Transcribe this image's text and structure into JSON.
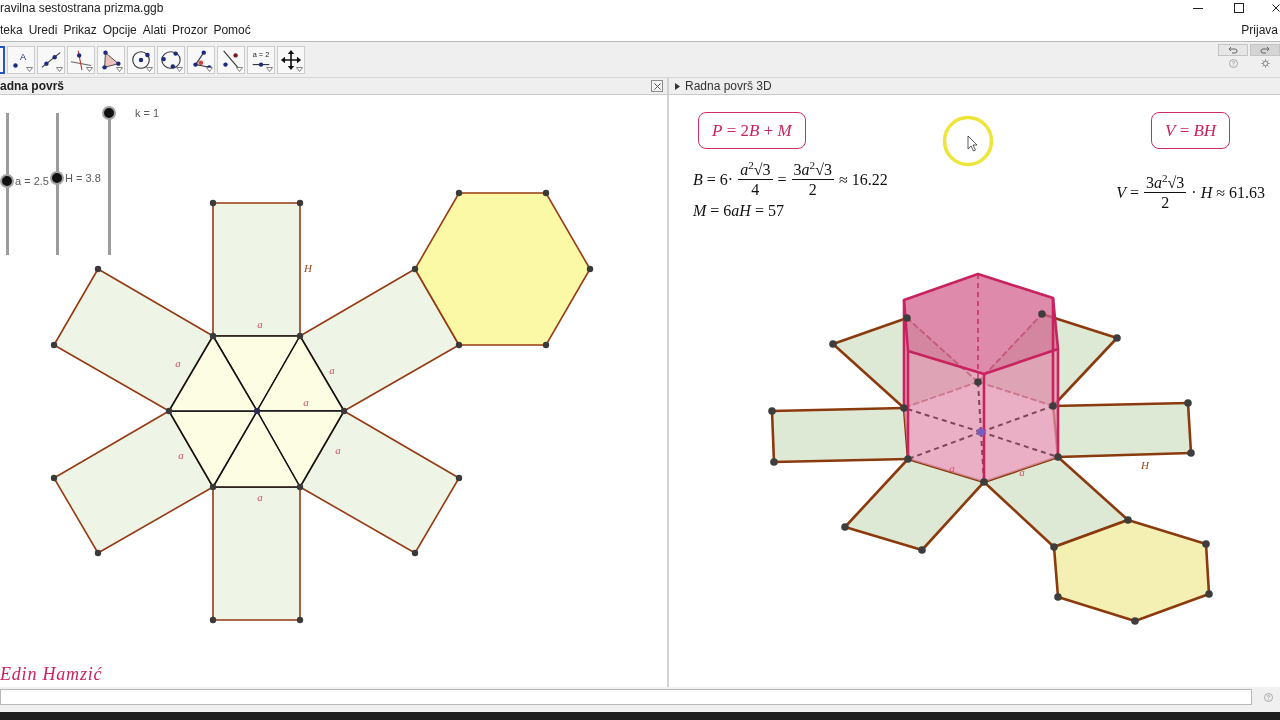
{
  "window": {
    "title": "ravilna sestostrana prizma.ggb"
  },
  "menu": {
    "items": [
      "teka",
      "Uredi",
      "Prikaz",
      "Opcije",
      "Alati",
      "Prozor",
      "Pomoć"
    ],
    "sign_in": "Prijava"
  },
  "toolbar": {
    "tools": [
      {
        "kind": "move",
        "selected": true
      },
      {
        "kind": "point",
        "selected": false,
        "text": "A"
      },
      {
        "kind": "line",
        "selected": false
      },
      {
        "kind": "perpendicular",
        "selected": false
      },
      {
        "kind": "polygon",
        "selected": false
      },
      {
        "kind": "circle",
        "selected": false
      },
      {
        "kind": "circle_three_points",
        "selected": false
      },
      {
        "kind": "angle",
        "selected": false
      },
      {
        "kind": "reflect",
        "selected": false
      },
      {
        "kind": "slider",
        "selected": false,
        "text": "a = 2"
      },
      {
        "kind": "move_view",
        "selected": false
      }
    ]
  },
  "graphics_view": {
    "title": "adna površ",
    "active": true,
    "sliders": [
      {
        "label": "a = 2.5",
        "level": 0.52
      },
      {
        "label": "H = 3.8",
        "level": 0.54
      },
      {
        "label": "k = 1",
        "level": 1
      }
    ],
    "labels": [
      {
        "kind": "height",
        "text": "H"
      },
      {
        "kind": "edge",
        "text": "a"
      },
      {
        "kind": "edge",
        "text": "a"
      },
      {
        "kind": "edge",
        "text": "a"
      },
      {
        "kind": "edge",
        "text": "a"
      },
      {
        "kind": "edge",
        "text": "a"
      },
      {
        "kind": "edge",
        "text": "a"
      },
      {
        "kind": "edge",
        "text": "a"
      }
    ],
    "author": "Edin Hamzić"
  },
  "view_3d": {
    "title": "Radna površ 3D",
    "active": false,
    "columns": [
      {
        "box": "P = 2B + M",
        "formulas": [
          {
            "parts": [
              {
                "kind": "text",
                "text": "B = 6·"
              },
              {
                "kind": "fraction",
                "numerator": "a$^{2}$√3",
                "denominator": "4"
              },
              {
                "kind": "text",
                "text": "="
              },
              {
                "kind": "fraction",
                "numerator": "3a$^{2}$√3",
                "denominator": "2"
              },
              {
                "kind": "text",
                "text": "≈ 16.22"
              }
            ]
          },
          {
            "parts": [
              {
                "kind": "text",
                "text": "M = 6aH = 57"
              }
            ]
          }
        ]
      },
      {
        "box": "V = BH",
        "formulas": [
          {
            "parts": [
              {
                "kind": "text",
                "text": "V ="
              },
              {
                "kind": "fraction",
                "numerator": "3a$^{2}$√3",
                "denominator": "2"
              },
              {
                "kind": "text",
                "text": "· H ≈ 61.63"
              }
            ]
          }
        ]
      }
    ],
    "labels": [
      {
        "kind": "edge",
        "text": "a"
      },
      {
        "kind": "edge",
        "text": "a"
      },
      {
        "kind": "height",
        "text": "H"
      }
    ]
  }
}
